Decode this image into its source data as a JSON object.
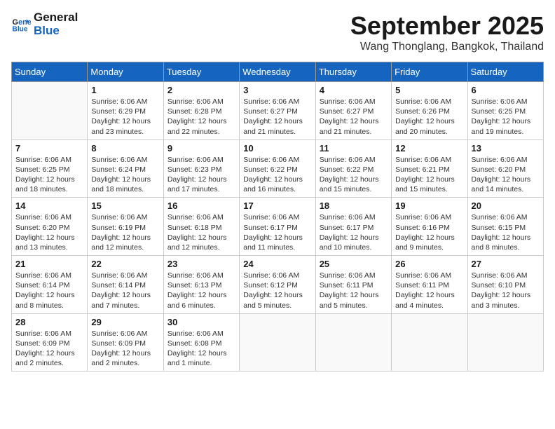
{
  "header": {
    "logo_line1": "General",
    "logo_line2": "Blue",
    "month": "September 2025",
    "location": "Wang Thonglang, Bangkok, Thailand"
  },
  "weekdays": [
    "Sunday",
    "Monday",
    "Tuesday",
    "Wednesday",
    "Thursday",
    "Friday",
    "Saturday"
  ],
  "weeks": [
    [
      {
        "day": "",
        "info": ""
      },
      {
        "day": "1",
        "info": "Sunrise: 6:06 AM\nSunset: 6:29 PM\nDaylight: 12 hours\nand 23 minutes."
      },
      {
        "day": "2",
        "info": "Sunrise: 6:06 AM\nSunset: 6:28 PM\nDaylight: 12 hours\nand 22 minutes."
      },
      {
        "day": "3",
        "info": "Sunrise: 6:06 AM\nSunset: 6:27 PM\nDaylight: 12 hours\nand 21 minutes."
      },
      {
        "day": "4",
        "info": "Sunrise: 6:06 AM\nSunset: 6:27 PM\nDaylight: 12 hours\nand 21 minutes."
      },
      {
        "day": "5",
        "info": "Sunrise: 6:06 AM\nSunset: 6:26 PM\nDaylight: 12 hours\nand 20 minutes."
      },
      {
        "day": "6",
        "info": "Sunrise: 6:06 AM\nSunset: 6:25 PM\nDaylight: 12 hours\nand 19 minutes."
      }
    ],
    [
      {
        "day": "7",
        "info": "Sunrise: 6:06 AM\nSunset: 6:25 PM\nDaylight: 12 hours\nand 18 minutes."
      },
      {
        "day": "8",
        "info": "Sunrise: 6:06 AM\nSunset: 6:24 PM\nDaylight: 12 hours\nand 18 minutes."
      },
      {
        "day": "9",
        "info": "Sunrise: 6:06 AM\nSunset: 6:23 PM\nDaylight: 12 hours\nand 17 minutes."
      },
      {
        "day": "10",
        "info": "Sunrise: 6:06 AM\nSunset: 6:22 PM\nDaylight: 12 hours\nand 16 minutes."
      },
      {
        "day": "11",
        "info": "Sunrise: 6:06 AM\nSunset: 6:22 PM\nDaylight: 12 hours\nand 15 minutes."
      },
      {
        "day": "12",
        "info": "Sunrise: 6:06 AM\nSunset: 6:21 PM\nDaylight: 12 hours\nand 15 minutes."
      },
      {
        "day": "13",
        "info": "Sunrise: 6:06 AM\nSunset: 6:20 PM\nDaylight: 12 hours\nand 14 minutes."
      }
    ],
    [
      {
        "day": "14",
        "info": "Sunrise: 6:06 AM\nSunset: 6:20 PM\nDaylight: 12 hours\nand 13 minutes."
      },
      {
        "day": "15",
        "info": "Sunrise: 6:06 AM\nSunset: 6:19 PM\nDaylight: 12 hours\nand 12 minutes."
      },
      {
        "day": "16",
        "info": "Sunrise: 6:06 AM\nSunset: 6:18 PM\nDaylight: 12 hours\nand 12 minutes."
      },
      {
        "day": "17",
        "info": "Sunrise: 6:06 AM\nSunset: 6:17 PM\nDaylight: 12 hours\nand 11 minutes."
      },
      {
        "day": "18",
        "info": "Sunrise: 6:06 AM\nSunset: 6:17 PM\nDaylight: 12 hours\nand 10 minutes."
      },
      {
        "day": "19",
        "info": "Sunrise: 6:06 AM\nSunset: 6:16 PM\nDaylight: 12 hours\nand 9 minutes."
      },
      {
        "day": "20",
        "info": "Sunrise: 6:06 AM\nSunset: 6:15 PM\nDaylight: 12 hours\nand 8 minutes."
      }
    ],
    [
      {
        "day": "21",
        "info": "Sunrise: 6:06 AM\nSunset: 6:14 PM\nDaylight: 12 hours\nand 8 minutes."
      },
      {
        "day": "22",
        "info": "Sunrise: 6:06 AM\nSunset: 6:14 PM\nDaylight: 12 hours\nand 7 minutes."
      },
      {
        "day": "23",
        "info": "Sunrise: 6:06 AM\nSunset: 6:13 PM\nDaylight: 12 hours\nand 6 minutes."
      },
      {
        "day": "24",
        "info": "Sunrise: 6:06 AM\nSunset: 6:12 PM\nDaylight: 12 hours\nand 5 minutes."
      },
      {
        "day": "25",
        "info": "Sunrise: 6:06 AM\nSunset: 6:11 PM\nDaylight: 12 hours\nand 5 minutes."
      },
      {
        "day": "26",
        "info": "Sunrise: 6:06 AM\nSunset: 6:11 PM\nDaylight: 12 hours\nand 4 minutes."
      },
      {
        "day": "27",
        "info": "Sunrise: 6:06 AM\nSunset: 6:10 PM\nDaylight: 12 hours\nand 3 minutes."
      }
    ],
    [
      {
        "day": "28",
        "info": "Sunrise: 6:06 AM\nSunset: 6:09 PM\nDaylight: 12 hours\nand 2 minutes."
      },
      {
        "day": "29",
        "info": "Sunrise: 6:06 AM\nSunset: 6:09 PM\nDaylight: 12 hours\nand 2 minutes."
      },
      {
        "day": "30",
        "info": "Sunrise: 6:06 AM\nSunset: 6:08 PM\nDaylight: 12 hours\nand 1 minute."
      },
      {
        "day": "",
        "info": ""
      },
      {
        "day": "",
        "info": ""
      },
      {
        "day": "",
        "info": ""
      },
      {
        "day": "",
        "info": ""
      }
    ]
  ]
}
